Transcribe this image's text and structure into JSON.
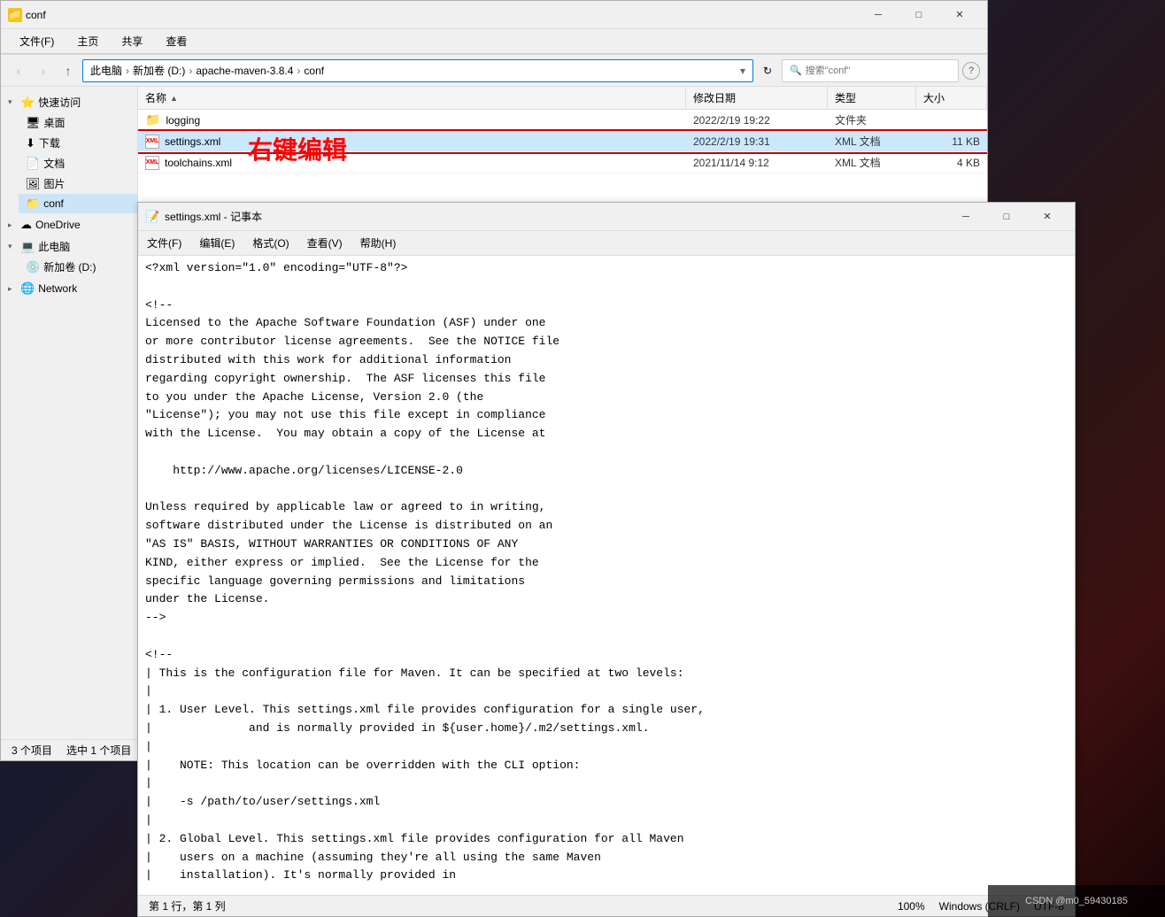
{
  "desktop": {
    "bg_color": "#1a1a2e"
  },
  "explorer": {
    "title": "conf",
    "title_icon": "📁",
    "tabs": [
      "文件(F)",
      "主页",
      "共享",
      "查看"
    ],
    "address": {
      "parts": [
        "此电脑",
        "新加卷 (D:)",
        "apache-maven-3.8.4",
        "conf"
      ],
      "separators": [
        "›",
        "›",
        "›"
      ]
    },
    "search_placeholder": "搜索\"conf\"",
    "back_btn": "‹",
    "forward_btn": "›",
    "up_btn": "↑",
    "columns": {
      "name": "名称",
      "date": "修改日期",
      "type": "类型",
      "size": "大小"
    },
    "files": [
      {
        "name": "logging",
        "type_icon": "folder",
        "date": "2022/2/19 19:22",
        "file_type": "文件夹",
        "size": "",
        "selected": false,
        "highlighted": false
      },
      {
        "name": "settings.xml",
        "type_icon": "xml",
        "date": "2022/2/19 19:31",
        "file_type": "XML 文档",
        "size": "11 KB",
        "selected": true,
        "highlighted": true
      },
      {
        "name": "toolchains.xml",
        "type_icon": "xml",
        "date": "2021/11/14 9:12",
        "file_type": "XML 文档",
        "size": "4 KB",
        "selected": false,
        "highlighted": false
      }
    ],
    "status": {
      "count": "3 个项目",
      "selected": "选中 1 个项目"
    },
    "sidebar": {
      "quick_access": {
        "label": "快速访问",
        "items": [
          "桌面",
          "下载",
          "文档",
          "图片",
          "conf"
        ]
      },
      "onedrive": "OneDrive",
      "this_pc": "此电脑",
      "new_volume": "新加卷 (D:)",
      "network": "Network"
    }
  },
  "annotation": {
    "text": "右键编辑",
    "color": "#ff0000"
  },
  "notepad": {
    "title": "settings.xml - 记事本",
    "title_icon": "📝",
    "menu": [
      "文件(F)",
      "编辑(E)",
      "格式(O)",
      "查看(V)",
      "帮助(H)"
    ],
    "content_lines": [
      "<?xml version=\"1.0\" encoding=\"UTF-8\"?>",
      "",
      "<!--",
      "Licensed to the Apache Software Foundation (ASF) under one",
      "or more contributor license agreements.  See the NOTICE file",
      "distributed with this work for additional information",
      "regarding copyright ownership.  The ASF licenses this file",
      "to you under the Apache License, Version 2.0 (the",
      "\"License\"); you may not use this file except in compliance",
      "with the License.  You may obtain a copy of the License at",
      "",
      "    http://www.apache.org/licenses/LICENSE-2.0",
      "",
      "Unless required by applicable law or agreed to in writing,",
      "software distributed under the License is distributed on an",
      "\"AS IS\" BASIS, WITHOUT WARRANTIES OR CONDITIONS OF ANY",
      "KIND, either express or implied.  See the License for the",
      "specific language governing permissions and limitations",
      "under the License.",
      "-->",
      "",
      "<!--",
      "| This is the configuration file for Maven. It can be specified at two levels:",
      "|",
      "| 1. User Level. This settings.xml file provides configuration for a single user,",
      "|              and is normally provided in ${user.home}/.m2/settings.xml.",
      "|",
      "|    NOTE: This location can be overridden with the CLI option:",
      "|",
      "|    -s /path/to/user/settings.xml",
      "|",
      "| 2. Global Level. This settings.xml file provides configuration for all Maven",
      "|    users on a machine (assuming they're all using the same Maven",
      "|    installation). It's normally provided in"
    ],
    "statusbar": {
      "position": "第 1 行，第 1 列",
      "zoom": "100%",
      "line_ending": "Windows (CRLF)",
      "encoding": "UTF-8"
    }
  },
  "csdn": {
    "watermark": "CSDN @m0_59430185"
  }
}
